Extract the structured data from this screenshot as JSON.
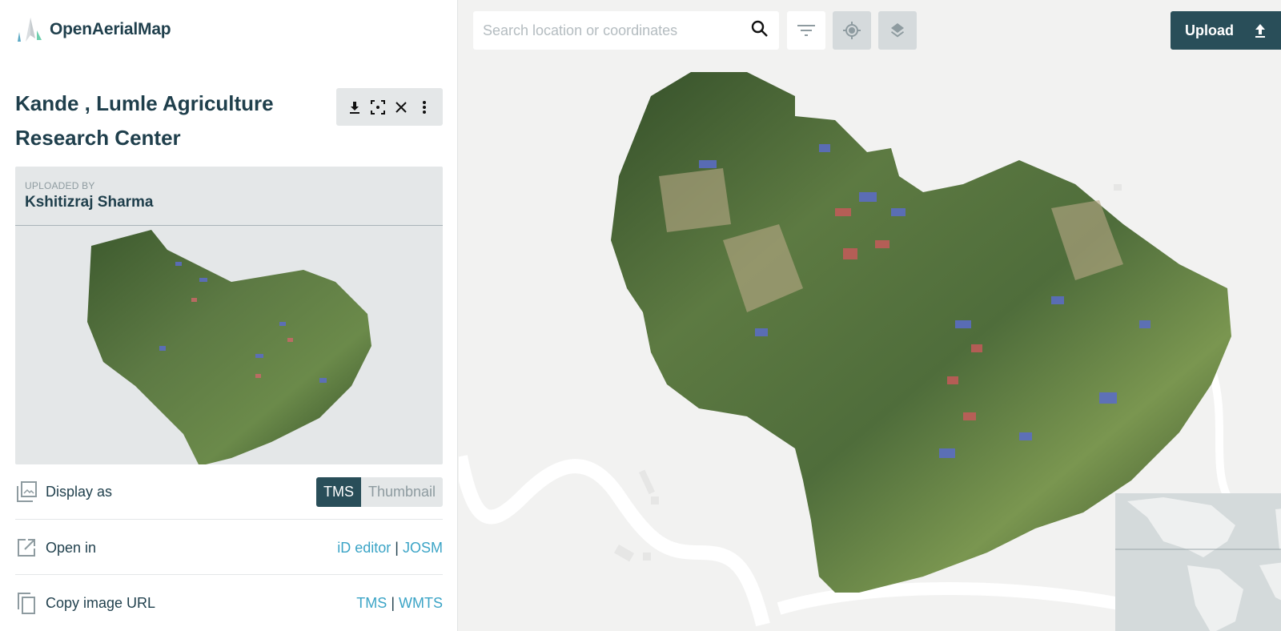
{
  "brand": {
    "name": "OpenAerialMap"
  },
  "image": {
    "title": "Kande , Lumle Agriculture Research Center",
    "uploaded_by_label": "UPLOADED BY",
    "uploaded_by": "Kshitizraj Sharma"
  },
  "actions": [
    {
      "name": "download",
      "icon": "download-icon"
    },
    {
      "name": "zoom-to-fit",
      "icon": "focus-icon"
    },
    {
      "name": "close",
      "icon": "close-icon"
    },
    {
      "name": "more",
      "icon": "more-vert-icon"
    }
  ],
  "details": {
    "display_as": {
      "label": "Display as",
      "options": [
        "TMS",
        "Thumbnail"
      ],
      "selected": "TMS"
    },
    "open_in": {
      "label": "Open in",
      "links": [
        "iD editor",
        "JOSM"
      ],
      "separator": "|"
    },
    "copy_url": {
      "label": "Copy image URL",
      "links": [
        "TMS",
        "WMTS"
      ],
      "separator": "|"
    }
  },
  "map": {
    "search_placeholder": "Search location or coordinates",
    "upload_label": "Upload"
  },
  "colors": {
    "primary": "#294e59",
    "link": "#3ba4c6",
    "heading": "#1f3f4c"
  }
}
